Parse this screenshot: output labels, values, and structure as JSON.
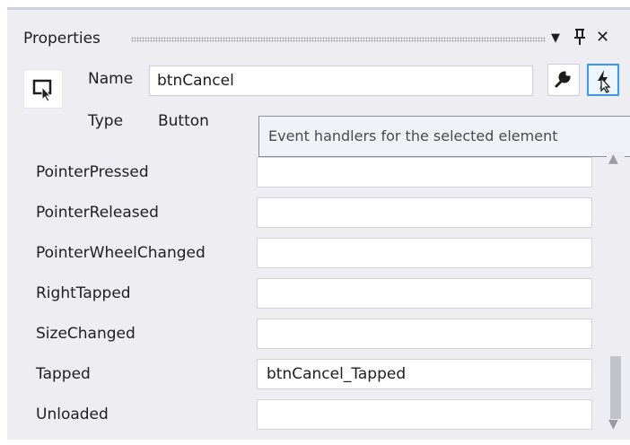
{
  "panel": {
    "title": "Properties",
    "dropdown_icon": "▼",
    "pin_icon": "pin-icon",
    "close_icon": "✕"
  },
  "header": {
    "name_label": "Name",
    "name_value": "btnCancel",
    "type_label": "Type",
    "type_value": "Button",
    "properties_view_icon": "wrench-icon",
    "events_view_icon": "lightning-icon",
    "tooltip": "Event handlers for the selected element"
  },
  "events": [
    {
      "name": "PointerPressed",
      "handler": ""
    },
    {
      "name": "PointerReleased",
      "handler": ""
    },
    {
      "name": "PointerWheelChanged",
      "handler": ""
    },
    {
      "name": "RightTapped",
      "handler": ""
    },
    {
      "name": "SizeChanged",
      "handler": ""
    },
    {
      "name": "Tapped",
      "handler": "btnCancel_Tapped"
    },
    {
      "name": "Unloaded",
      "handler": ""
    }
  ],
  "colors": {
    "panel_bg": "#eeeef2",
    "accent": "#3399ff",
    "border": "#cccedb"
  }
}
